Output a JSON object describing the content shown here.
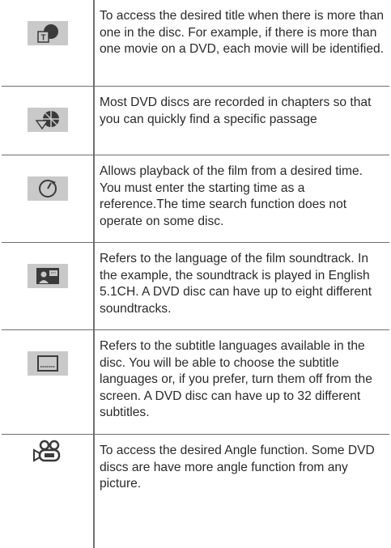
{
  "rows": [
    {
      "icon": "title-disc-icon",
      "text": "To access the desired title when there is more than one in the disc. For example, if there is more than one movie on a DVD, each movie will be identified."
    },
    {
      "icon": "chapter-icon",
      "text": "Most DVD discs are recorded in chapters so that you can quickly find a specific passage"
    },
    {
      "icon": "time-search-icon",
      "text": "Allows playback of the film from a desired time. You must enter the starting time as a reference.The time search function does not operate on some disc."
    },
    {
      "icon": "audio-language-icon",
      "text": "Refers to the language of the film soundtrack. In the example, the soundtrack is played in English 5.1CH. A DVD disc can have up to eight different soundtracks."
    },
    {
      "icon": "subtitle-icon",
      "text": "Refers to the subtitle languages available in the disc. You will be able to choose the subtitle languages or, if you prefer, turn them off from the screen. A DVD disc can have up to 32 different subtitles."
    },
    {
      "icon": "angle-camera-icon",
      "text": "To access the desired Angle function. Some DVD discs are have more angle function from any picture."
    }
  ]
}
